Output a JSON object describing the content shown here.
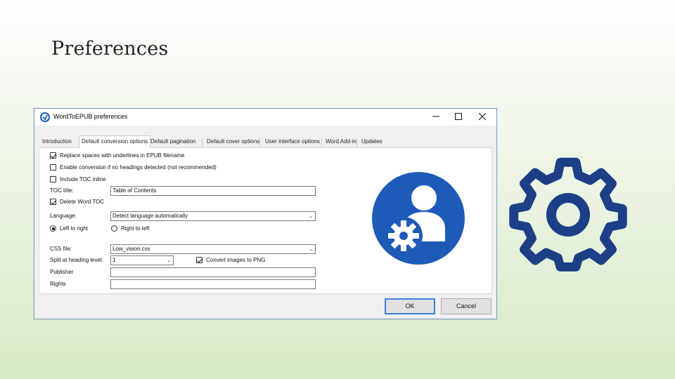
{
  "slide": {
    "title": "Preferences"
  },
  "window": {
    "title": "WordToEPUB preferences",
    "controls": {
      "minimize": "─",
      "maximize": "☐",
      "close": "✕"
    }
  },
  "tabs": [
    {
      "label": "Introduction",
      "active": false
    },
    {
      "label": "Default conversion options",
      "active": true
    },
    {
      "label": "Default pagination",
      "active": false
    },
    {
      "label": "Default cover options",
      "active": false
    },
    {
      "label": "User interface options",
      "active": false
    },
    {
      "label": "Word Add-in",
      "active": false
    },
    {
      "label": "Updates",
      "active": false
    }
  ],
  "options": {
    "replace_spaces": {
      "label": "Replace spaces with underlines in EPUB filename",
      "checked": true
    },
    "enable_conversion": {
      "label": "Enable conversion if no headings detected (not recommended)",
      "checked": false
    },
    "include_toc": {
      "label": "Include TOC inline",
      "checked": false
    },
    "toc_title": {
      "label": "TOC title:",
      "value": "Table of Contents"
    },
    "delete_word_toc": {
      "label": "Delete Word TOC",
      "checked": true
    },
    "language": {
      "label": "Language:",
      "value": "Detect language automatically"
    },
    "direction": {
      "ltr": {
        "label": "Left to right",
        "selected": true
      },
      "rtl": {
        "label": "Right to left",
        "selected": false
      }
    },
    "css_file": {
      "label": "CSS file:",
      "value": "Low_vision.css"
    },
    "split_heading": {
      "label": "Split at heading level:",
      "value": "1"
    },
    "convert_png": {
      "label": "Convert images to PNG",
      "checked": true
    },
    "publisher": {
      "label": "Publisher",
      "value": ""
    },
    "rights": {
      "label": "Rights",
      "value": ""
    }
  },
  "buttons": {
    "ok": "OK",
    "cancel": "Cancel"
  },
  "icons": {
    "user_settings": "user-with-gear-icon",
    "gear": "gear-outline-icon",
    "blue": "#1e5bb8",
    "dark_blue": "#1c3f87"
  }
}
